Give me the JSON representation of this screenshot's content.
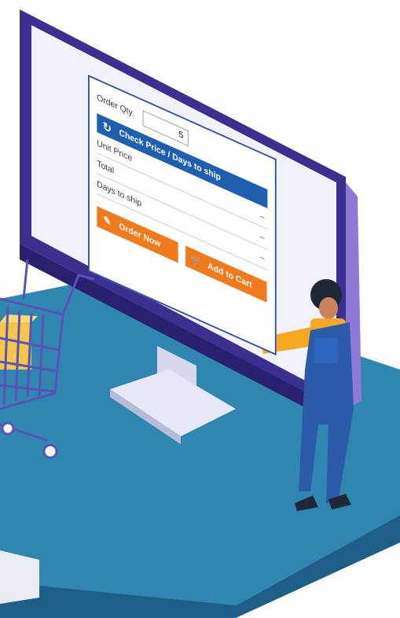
{
  "order_form": {
    "qty_label": "Order Qty.",
    "qty_value": "5",
    "check_button_label": "Check Price / Days to ship",
    "unit_price_label": "Unit Price",
    "unit_price_value": "–",
    "total_label": "Total",
    "total_value": "–",
    "days_label": "Days to ship",
    "days_value": "–",
    "order_now_label": "Order Now",
    "add_to_cart_label": "Add to Cart"
  },
  "icons": {
    "refresh": "refresh-icon",
    "order": "order-document-icon",
    "cart": "cart-icon"
  },
  "colors": {
    "primary_blue": "#1f5fb0",
    "accent_orange": "#f07a1c",
    "monitor_frame": "#3b2f8f",
    "floor_teal": "#2f86b0"
  }
}
